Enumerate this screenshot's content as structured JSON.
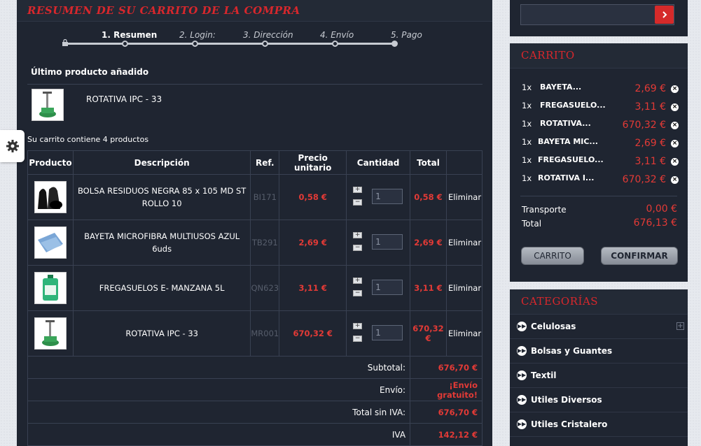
{
  "main": {
    "title": "RESUMEN DE SU CARRITO DE LA COMPRA",
    "steps": [
      "1. Resumen",
      "2. Login:",
      "3. Dirección",
      "4. Envío",
      "5. Pago"
    ],
    "last_added_label": "Último producto añadido",
    "last_added_name": "ROTATIVA IPC - 33",
    "cart_count": "Su carrito contiene 4 productos",
    "headers": [
      "Producto",
      "Descripción",
      "Ref.",
      "Precio unitario",
      "Cantidad",
      "Total"
    ],
    "rows": [
      {
        "desc": "BOLSA RESIDUOS NEGRA 85 x 105 MD ST ROLLO 10",
        "ref": "BI171",
        "unit": "0,58 €",
        "qty": "1",
        "total": "0,58 €",
        "remove": "Eliminar"
      },
      {
        "desc": "BAYETA MICROFIBRA MULTIUSOS AZUL 6uds",
        "ref": "TB291",
        "unit": "2,69 €",
        "qty": "1",
        "total": "2,69 €",
        "remove": "Eliminar"
      },
      {
        "desc": "FREGASUELOS E- MANZANA 5L",
        "ref": "QN623",
        "unit": "3,11 €",
        "qty": "1",
        "total": "3,11 €",
        "remove": "Eliminar"
      },
      {
        "desc": "ROTATIVA IPC - 33",
        "ref": "MR001",
        "unit": "670,32 €",
        "qty": "1",
        "total": "670,32 €",
        "remove": "Eliminar"
      }
    ],
    "totals": [
      {
        "label": "Subtotal:",
        "value": "676,70 €"
      },
      {
        "label": "Envío:",
        "value": "¡Envío gratuito!"
      },
      {
        "label": "Total sin IVA:",
        "value": "676,70 €"
      },
      {
        "label": "IVA",
        "value": "142,12 €"
      }
    ]
  },
  "sidebar": {
    "search_placeholder": "",
    "cart_title": "CARRITO",
    "cart_items": [
      {
        "qty": "1x",
        "name": "BAYETA...",
        "price": "2,69 €"
      },
      {
        "qty": "1x",
        "name": "FREGASUELO...",
        "price": "3,11 €"
      },
      {
        "qty": "1x",
        "name": "ROTATIVA...",
        "price": "670,32 €"
      },
      {
        "qty": "1x",
        "name": "BAYETA MIC...",
        "price": "2,69 €"
      },
      {
        "qty": "1x",
        "name": "FREGASUELO...",
        "price": "3,11 €"
      },
      {
        "qty": "1x",
        "name": "ROTATIVA I...",
        "price": "670,32 €"
      }
    ],
    "shipping_label": "Transporte",
    "shipping_value": "0,00 €",
    "total_label": "Total",
    "total_value": "676,13 €",
    "cart_button": "CARRITO",
    "confirm_button": "CONFIRMAR",
    "categories_title": "CATEGORÍAS",
    "categories": [
      "Celulosas",
      "Bolsas y Guantes",
      "Textil",
      "Utiles Diversos",
      "Utiles Cristalero"
    ]
  },
  "colors": {
    "accent": "#d8272c",
    "price": "#e23a36",
    "panel": "#1f2531"
  },
  "icons": [
    "gear-icon",
    "lock-icon",
    "search-arrow-icon",
    "remove-icon",
    "arrow-icon",
    "plus-icon"
  ]
}
